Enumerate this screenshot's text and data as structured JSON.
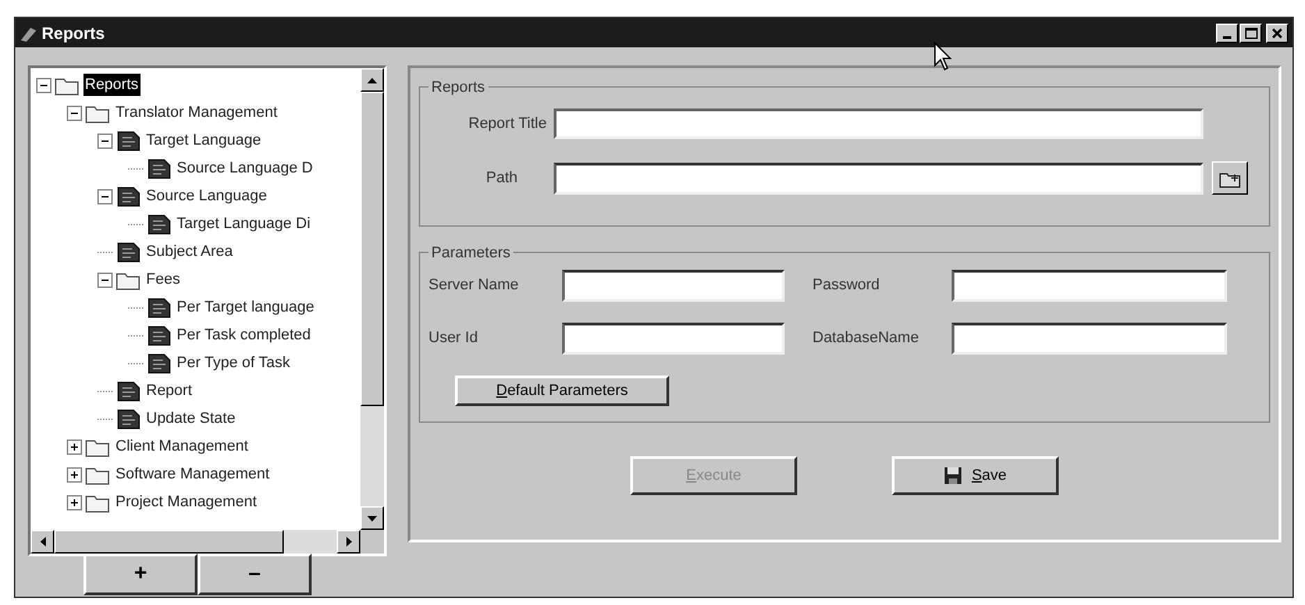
{
  "window": {
    "title": "Reports"
  },
  "tree": [
    {
      "label": "Reports",
      "kind": "folder",
      "selected": true,
      "expanded": true,
      "children": [
        {
          "label": "Translator Management",
          "kind": "folder",
          "selected": false,
          "expanded": true,
          "children": [
            {
              "label": "Target Language",
              "kind": "report",
              "selected": false,
              "expanded": true,
              "children": [
                {
                  "label": "Source Language D",
                  "kind": "report",
                  "selected": false
                }
              ]
            },
            {
              "label": "Source Language",
              "kind": "report",
              "selected": false,
              "expanded": true,
              "children": [
                {
                  "label": "Target Language Di",
                  "kind": "report",
                  "selected": false
                }
              ]
            },
            {
              "label": "Subject Area",
              "kind": "report",
              "selected": false
            },
            {
              "label": "Fees",
              "kind": "folder",
              "selected": false,
              "expanded": true,
              "children": [
                {
                  "label": "Per Target language",
                  "kind": "report",
                  "selected": false
                },
                {
                  "label": "Per Task completed",
                  "kind": "report",
                  "selected": false
                },
                {
                  "label": "Per Type of Task",
                  "kind": "report",
                  "selected": false
                }
              ]
            },
            {
              "label": "Report",
              "kind": "report",
              "selected": false
            },
            {
              "label": "Update State",
              "kind": "report",
              "selected": false
            }
          ]
        },
        {
          "label": "Client Management",
          "kind": "folder",
          "selected": false,
          "expanded": false
        },
        {
          "label": "Software Management",
          "kind": "folder",
          "selected": false,
          "expanded": false
        },
        {
          "label": "Project Management",
          "kind": "folder",
          "selected": false,
          "expanded": false
        }
      ]
    }
  ],
  "tree_buttons": [
    "+",
    "–"
  ],
  "reports_group": {
    "title": "Reports",
    "report_title_label": "Report Title",
    "path_label": "Path"
  },
  "parameters_group": {
    "title": "Parameters",
    "server_name_label": "Server Name",
    "password_label": "Password",
    "user_id_label": "User Id",
    "database_name_label": "DatabaseName",
    "default_button": "Default Parameters"
  },
  "actions": [
    {
      "label": "Execute",
      "kind": "execute",
      "disabled": true
    },
    {
      "label": "Save",
      "kind": "save",
      "disabled": false
    }
  ]
}
